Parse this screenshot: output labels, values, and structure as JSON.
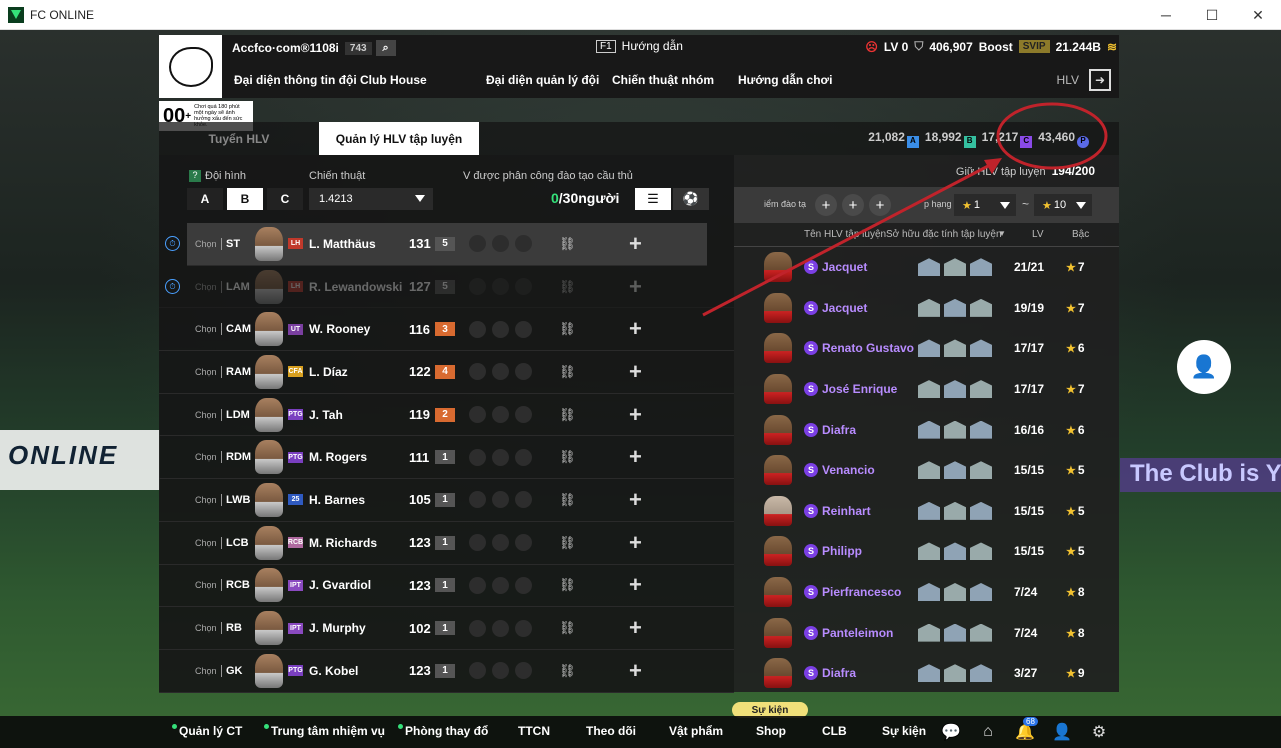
{
  "window": {
    "title": "FC ONLINE",
    "minimize": "─",
    "maximize": "☐",
    "close": "✕"
  },
  "background": {
    "banner_left": "ONLINE",
    "banner_right": "The Club is Y"
  },
  "badge": {
    "ovr": "00",
    "plus": "+",
    "desc": "Chơi quá 180 phút một ngày sẽ ảnh hưởng xấu đến sức khỏe."
  },
  "header": {
    "account_name": "Accfco·com®1108i",
    "account_level": "743",
    "search_icon": "⌕",
    "guide_key": "F1",
    "guide_label": "Hướng dẫn",
    "lv_label": "LV 0",
    "bp_value": "406,907",
    "boost_label": "Boost",
    "svip_label": "SVIP",
    "fc_value": "21.244B",
    "hlv_label": "HLV",
    "nav": [
      "Đại diện thông tin đội",
      "Club House",
      "Đại diện quản lý đội",
      "Chiến thuật nhóm",
      "Hướng dẫn chơi"
    ]
  },
  "tabs": {
    "tab1": "Tuyển HLV",
    "tab2": "Quản lý HLV tập luyện"
  },
  "currencies": [
    {
      "value": "21,082",
      "chip": "A",
      "color": "#3a8ee8"
    },
    {
      "value": "18,992",
      "chip": "B",
      "color": "#35c0a0"
    },
    {
      "value": "17,217",
      "chip": "C",
      "color": "#8a4ae8"
    },
    {
      "value": "43,460",
      "chip": "P",
      "color": "#5a6ae8"
    }
  ],
  "left_panel": {
    "formation_label": "Đội hình",
    "formation_help": "?",
    "formations": [
      "A",
      "B",
      "C"
    ],
    "tactic_label": "Chiến thuật",
    "tactic_value": "1.4213",
    "assignment_label": "V được phân công đào tạo cầu thủ",
    "assigned_count": "0",
    "assigned_total": "/30người",
    "list_view_icon": "☰",
    "field_view_icon": "⚽"
  },
  "players": [
    {
      "choose": "Chọn",
      "pos": "ST",
      "season": "LH",
      "season_color": "#c0392b",
      "name": "L. Matthäus",
      "ovr": "131",
      "lvl": "5",
      "lvl_color": "#555"
    },
    {
      "choose": "Chọn",
      "pos": "LAM",
      "season": "LH",
      "season_color": "#c0392b",
      "name": "R. Lewandowski",
      "ovr": "127",
      "lvl": "5",
      "lvl_color": "#555"
    },
    {
      "choose": "Chọn",
      "pos": "CAM",
      "season": "UT",
      "season_color": "#7a3fa0",
      "name": "W. Rooney",
      "ovr": "116",
      "lvl": "3",
      "lvl_color": "#d86a30"
    },
    {
      "choose": "Chọn",
      "pos": "RAM",
      "season": "CFA",
      "season_color": "#d8a020",
      "name": "L. Díaz",
      "ovr": "122",
      "lvl": "4",
      "lvl_color": "#d86a30"
    },
    {
      "choose": "Chọn",
      "pos": "LDM",
      "season": "PTG",
      "season_color": "#7a3fc0",
      "name": "J. Tah",
      "ovr": "119",
      "lvl": "2",
      "lvl_color": "#d86a30"
    },
    {
      "choose": "Chọn",
      "pos": "RDM",
      "season": "PTG",
      "season_color": "#7a3fc0",
      "name": "M. Rogers",
      "ovr": "111",
      "lvl": "1",
      "lvl_color": "#555"
    },
    {
      "choose": "Chọn",
      "pos": "LWB",
      "season": "25",
      "season_color": "#2f5ac0",
      "name": "H. Barnes",
      "ovr": "105",
      "lvl": "1",
      "lvl_color": "#555"
    },
    {
      "choose": "Chọn",
      "pos": "LCB",
      "season": "RCB",
      "season_color": "#b06aa0",
      "name": "M. Richards",
      "ovr": "123",
      "lvl": "1",
      "lvl_color": "#555"
    },
    {
      "choose": "Chọn",
      "pos": "RCB",
      "season": "IPT",
      "season_color": "#8a4ac0",
      "name": "J. Gvardiol",
      "ovr": "123",
      "lvl": "1",
      "lvl_color": "#555"
    },
    {
      "choose": "Chọn",
      "pos": "RB",
      "season": "IPT",
      "season_color": "#8a4ac0",
      "name": "J. Murphy",
      "ovr": "102",
      "lvl": "1",
      "lvl_color": "#555"
    },
    {
      "choose": "Chọn",
      "pos": "GK",
      "season": "PTG",
      "season_color": "#7a3fc0",
      "name": "G. Kobel",
      "ovr": "123",
      "lvl": "1",
      "lvl_color": "#555"
    }
  ],
  "right_panel": {
    "count_label": "Giữ HLV tập luyện",
    "count_value": "194/200",
    "filter_points": "iểm đào tạ",
    "filter_rank": "p hạng",
    "star_from": "1",
    "star_to": "10",
    "dash": "~",
    "col_name": "Tên HLV tập luyện",
    "col_traits": "Sở hữu đặc tính tập luyện",
    "col_lv": "LV",
    "col_rank": "Bậc"
  },
  "coaches": [
    {
      "badge": "S",
      "name": "Jacquet",
      "lv": "21/21",
      "rank": "7"
    },
    {
      "badge": "S",
      "name": "Jacquet",
      "lv": "19/19",
      "rank": "7"
    },
    {
      "badge": "S",
      "name": "Renato Gustavo",
      "lv": "17/17",
      "rank": "6"
    },
    {
      "badge": "S",
      "name": "José Enrique",
      "lv": "17/17",
      "rank": "7"
    },
    {
      "badge": "S",
      "name": "Diafra",
      "lv": "16/16",
      "rank": "6"
    },
    {
      "badge": "S",
      "name": "Venancio",
      "lv": "15/15",
      "rank": "5"
    },
    {
      "badge": "S",
      "name": "Reinhart",
      "lv": "15/15",
      "rank": "5"
    },
    {
      "badge": "S",
      "name": "Philipp",
      "lv": "15/15",
      "rank": "5"
    },
    {
      "badge": "S",
      "name": "Pierfrancesco",
      "lv": "7/24",
      "rank": "8"
    },
    {
      "badge": "S",
      "name": "Panteleimon",
      "lv": "7/24",
      "rank": "8"
    },
    {
      "badge": "S",
      "name": "Diafra",
      "lv": "3/27",
      "rank": "9"
    }
  ],
  "bottom": {
    "event_pill": "Sự kiện",
    "nav": [
      "Quản lý CT",
      "Trung tâm nhiệm vụ",
      "Phòng thay đổ",
      "TTCN",
      "Theo dõi",
      "Vật phẩm",
      "Shop",
      "CLB",
      "Sự kiện"
    ],
    "notif_count": "68"
  },
  "colors": {
    "annotation_red": "#c0232b",
    "accent_green": "#35e07a",
    "coach_name_purple": "#b88cff"
  }
}
